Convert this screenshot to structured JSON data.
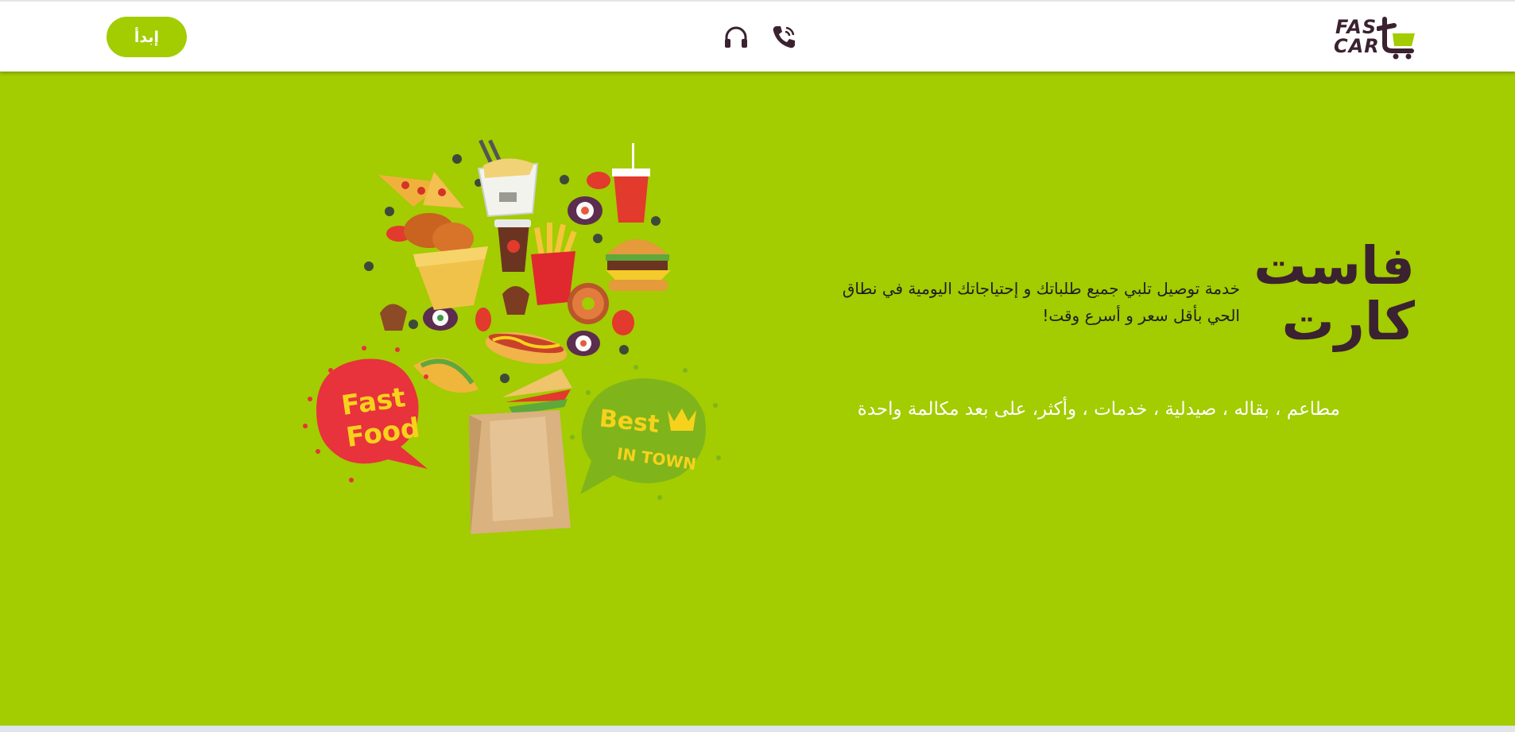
{
  "header": {
    "start_label": "إبدأ",
    "logo": {
      "line1": "FAS",
      "line2": "CAR",
      "icon": "cart-t-logo-icon"
    },
    "icons": [
      "headphones-icon",
      "phone-call-icon"
    ]
  },
  "hero": {
    "title_line1": "فاست",
    "title_line2": "كارت",
    "description": "خدمة توصيل تلبي جميع طلباتك و إحتياجاتك اليومية في نطاق الحي بأقل سعر و أسرع وقت!",
    "services": "مطاعم ، بقاله ، صيدلية ، خدمات ، وأكثر، على بعد مكالمة واحدة"
  },
  "illustration": {
    "left_bubble_line1": "Fast",
    "left_bubble_line2": "Food",
    "right_bubble_line1": "Best",
    "right_bubble_line2": "IN TOWN"
  },
  "colors": {
    "accent": "#a3cc01",
    "dark": "#3b2230",
    "red_bubble": "#e8323c",
    "green_bubble": "#7fb51a",
    "bubble_text": "#f7d21c"
  }
}
